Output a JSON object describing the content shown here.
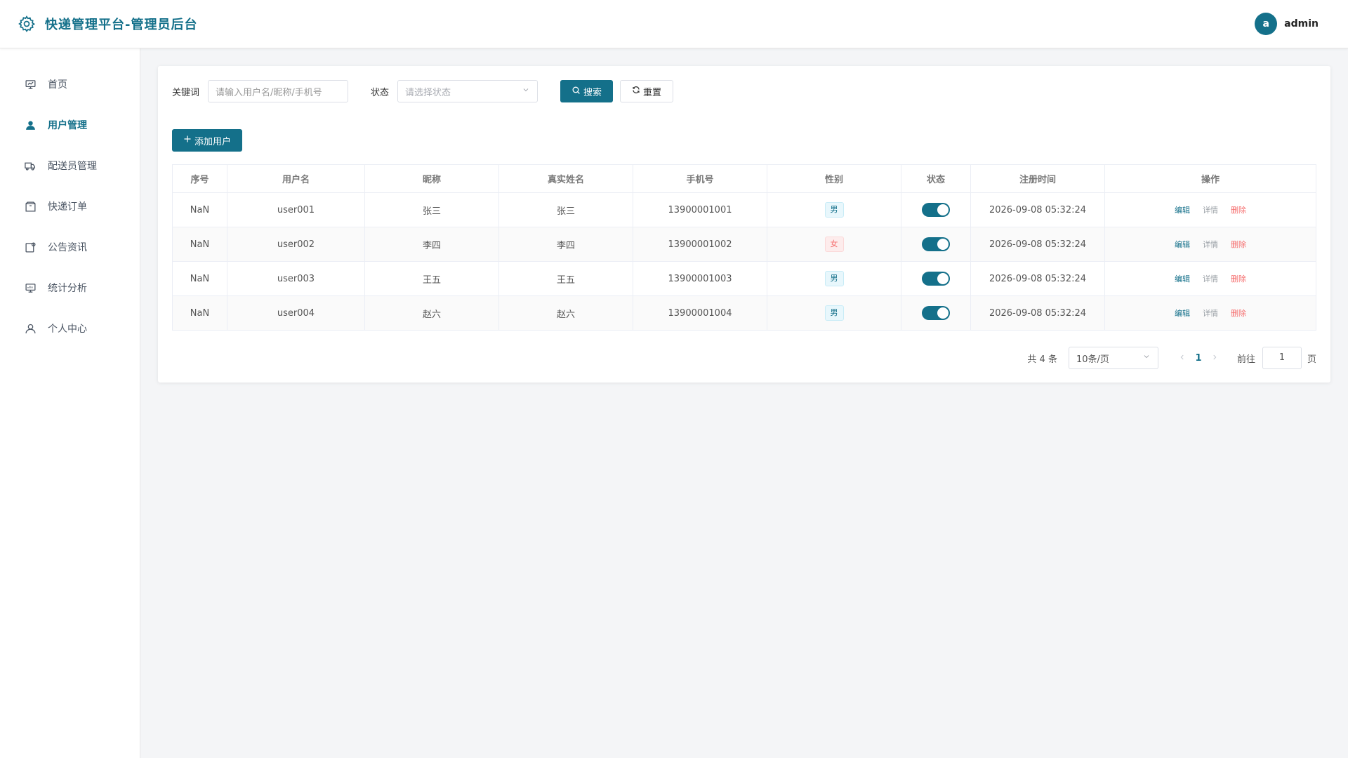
{
  "header": {
    "title": "快递管理平台-管理员后台",
    "avatar_letter": "a",
    "username": "admin"
  },
  "sidebar": {
    "items": [
      {
        "label": "首页",
        "icon": "monitor-icon",
        "active": false
      },
      {
        "label": "用户管理",
        "icon": "user-filled-icon",
        "active": true
      },
      {
        "label": "配送员管理",
        "icon": "truck-icon",
        "active": false
      },
      {
        "label": "快递订单",
        "icon": "box-icon",
        "active": false
      },
      {
        "label": "公告资讯",
        "icon": "notice-icon",
        "active": false
      },
      {
        "label": "统计分析",
        "icon": "chart-icon",
        "active": false
      },
      {
        "label": "个人中心",
        "icon": "user-icon",
        "active": false
      }
    ]
  },
  "filters": {
    "keyword_label": "关键词",
    "keyword_placeholder": "请输入用户名/昵称/手机号",
    "status_label": "状态",
    "status_placeholder": "请选择状态",
    "search_label": "搜索",
    "reset_label": "重置"
  },
  "actions": {
    "add_label": "添加用户"
  },
  "table": {
    "columns": [
      "序号",
      "用户名",
      "昵称",
      "真实姓名",
      "手机号",
      "性别",
      "状态",
      "注册时间",
      "操作"
    ],
    "rows": [
      {
        "index": "NaN",
        "username": "user001",
        "nickname": "张三",
        "realname": "张三",
        "phone": "13900001001",
        "gender": "男",
        "status_on": true,
        "created": "2026-09-08 05:32:24"
      },
      {
        "index": "NaN",
        "username": "user002",
        "nickname": "李四",
        "realname": "李四",
        "phone": "13900001002",
        "gender": "女",
        "status_on": true,
        "created": "2026-09-08 05:32:24"
      },
      {
        "index": "NaN",
        "username": "user003",
        "nickname": "王五",
        "realname": "王五",
        "phone": "13900001003",
        "gender": "男",
        "status_on": true,
        "created": "2026-09-08 05:32:24"
      },
      {
        "index": "NaN",
        "username": "user004",
        "nickname": "赵六",
        "realname": "赵六",
        "phone": "13900001004",
        "gender": "男",
        "status_on": true,
        "created": "2026-09-08 05:32:24"
      }
    ],
    "op_edit": "编辑",
    "op_detail": "详情",
    "op_delete": "删除"
  },
  "pagination": {
    "total_text": "共 4 条",
    "page_size": "10条/页",
    "current_page": "1",
    "goto_label": "前往",
    "goto_value": "1",
    "page_suffix": "页"
  },
  "colors": {
    "accent": "#14708a",
    "danger": "#f56c6c"
  }
}
